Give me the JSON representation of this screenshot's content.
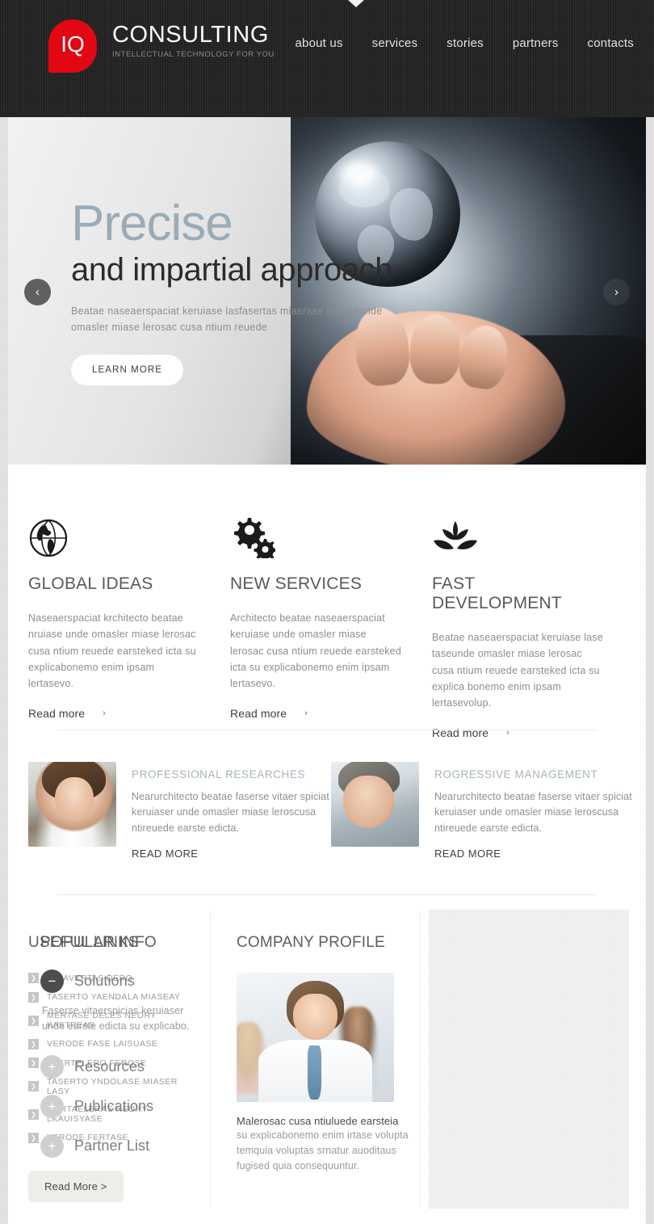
{
  "header": {
    "logo_initials": "IQ",
    "brand_name": "CONSULTING",
    "tagline": "INTELLECTUAL TECHNOLOGY FOR YOU",
    "nav": [
      {
        "label": "about us"
      },
      {
        "label": "services"
      },
      {
        "label": "stories"
      },
      {
        "label": "partners"
      },
      {
        "label": "contacts"
      }
    ],
    "background_color": "#272727",
    "accent_color": "#e30613"
  },
  "hero": {
    "title_line1": "Precise",
    "title_line2": "and impartial  approach",
    "description": "Beatae naseaerspaciat keruiase lasfasertas miaerase buasraunde omasler miase lerosac cusa ntium reuede",
    "button_label": "LEARN MORE",
    "prev_arrow": "‹",
    "next_arrow": "›",
    "title_color": "#9aabb7"
  },
  "features": [
    {
      "icon": "globe-icon",
      "title": "GLOBAL IDEAS",
      "text": "Naseaerspaciat krchitecto beatae nruiase unde omasler miase lerosac cusa ntium reuede earsteked icta su explicabonemo enim ipsam lertasevo.",
      "link_label": "Read more",
      "link_chevron": "›"
    },
    {
      "icon": "gears-icon",
      "title": "NEW SERVICES",
      "text": "Architecto beatae naseaerspaciat keruiase unde omasler miase lerosac cusa ntium reuede earsteked icta su explicabonemo enim ipsam lertasevo.",
      "link_label": "Read more",
      "link_chevron": "›"
    },
    {
      "icon": "leaves-icon",
      "title": "FAST DEVELOPMENT",
      "text": "Beatae naseaerspaciat keruiase lase taseunde omasler miase lerosac cusa ntium reuede earsteked icta su explica bonemo enim ipsam lertasevolup.",
      "link_label": "Read more",
      "link_chevron": "›"
    }
  ],
  "articles": [
    {
      "photo": "woman-portrait-photo",
      "title": "PROFESSIONAL RESEARCHES",
      "text": "Nearurchitecto beatae faserse vitaer spiciat keruiaser unde omasler miase leroscusa ntireuede earste edicta.",
      "link_label": "READ MORE"
    },
    {
      "photo": "man-portrait-photo",
      "title": "ROGRESSIVE MANAGEMENT",
      "text": "Nearurchitecto beatae faserse vitaer spiciat keruiaser unde omasler miase leroscusa ntireuede earste edicta.",
      "link_label": "READ MORE"
    }
  ],
  "useful_links": {
    "title": "USEFUL LINKS",
    "bullet_glyph": "❯",
    "items": [
      {
        "label": "SIT AVERTAS DERO"
      },
      {
        "label": "TASERTO YAENDALA MIASEAY"
      },
      {
        "label": "MERTASE DELES NEORY KASTREAS"
      },
      {
        "label": "VERODE FASE LAISUASE"
      },
      {
        "label": "AVERTELERO FEROSE"
      },
      {
        "label": "TASERTO YNDOLASE MIASER LASY"
      },
      {
        "label": "MERTAELERAS NEORY LKAUISYASE"
      },
      {
        "label": "VERODE FERTASE"
      }
    ],
    "button_label": "Read More >"
  },
  "company_profile": {
    "title": "COMPANY PROFILE",
    "photo": "team-photo",
    "caption": "Malerosac cusa ntiuluede earsteia",
    "text": "su explicabonemo enim irtase volupta temquia voluptas srnatur auoditaus fugised quia consequuntur."
  },
  "popular_info": {
    "title": "POPULAR INFO",
    "items": [
      {
        "label": "Solutions",
        "state": "open",
        "toggle_glyph": "−",
        "body": "Faserse vitaerspicias keruiaser unde earste edicta su explicabo."
      },
      {
        "label": "Resources",
        "state": "closed",
        "toggle_glyph": "+",
        "body": ""
      },
      {
        "label": "Publications",
        "state": "closed",
        "toggle_glyph": "+",
        "body": ""
      },
      {
        "label": "Partner List",
        "state": "closed",
        "toggle_glyph": "+",
        "body": ""
      }
    ]
  }
}
